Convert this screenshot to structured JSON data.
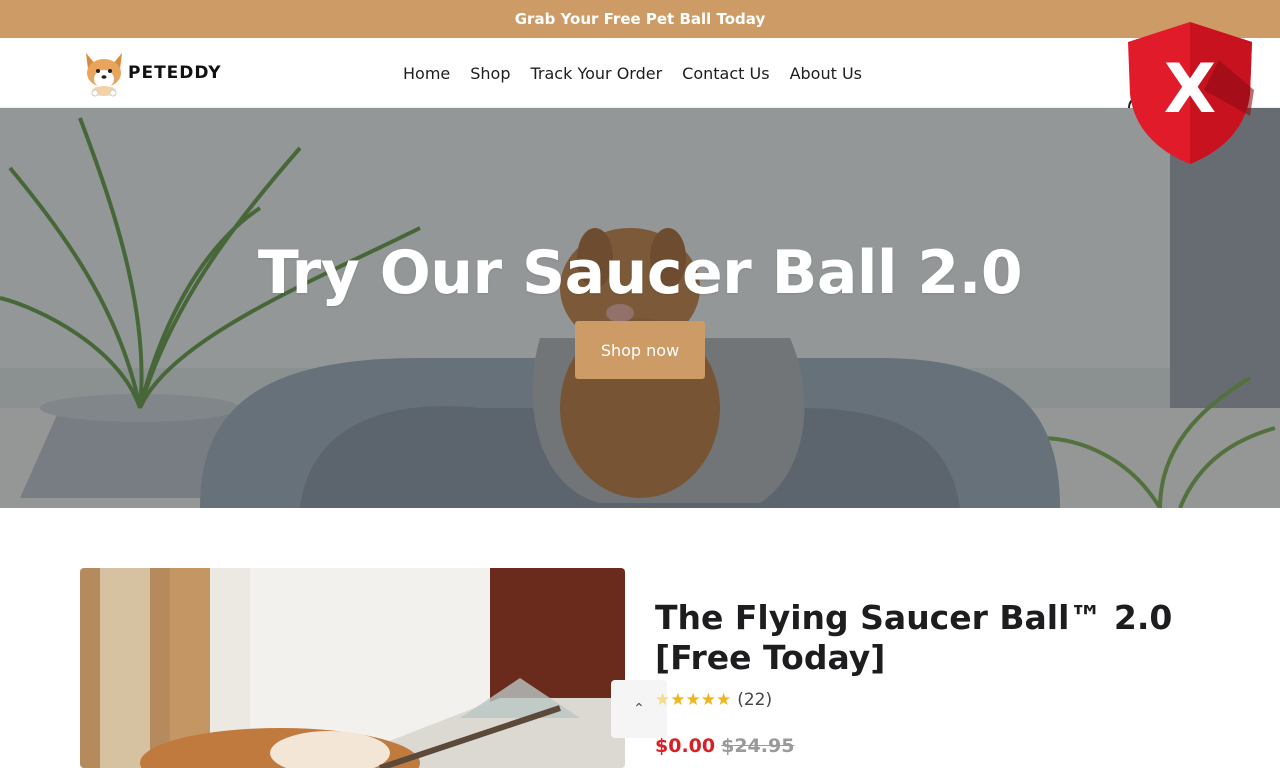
{
  "announcement": {
    "text": "Grab Your Free Pet Ball Today"
  },
  "header": {
    "logo_text": "PETEDDY",
    "nav": [
      "Home",
      "Shop",
      "Track Your Order",
      "Contact Us",
      "About Us"
    ]
  },
  "hero": {
    "title": "Try Our Saucer Ball 2.0",
    "button_label": "Shop now"
  },
  "product": {
    "title_line1": "The Flying Saucer Ball™ 2.0",
    "title_line2": "[Free Today]",
    "stars": "★★★★",
    "first_star": "★",
    "rating_count": "(22)",
    "price_now": "$0.00",
    "price_old": "$24.95",
    "thumb_arrow": "⌃"
  },
  "overlay": {
    "shield_letter": "X"
  },
  "colors": {
    "accent": "#cd9c66",
    "sale_red": "#d81f26",
    "shield_red": "#e11b2a"
  },
  "icons": [
    "corgi-logo-icon",
    "search-icon",
    "shield-close-icon",
    "chevron-up-icon",
    "star-icon"
  ]
}
